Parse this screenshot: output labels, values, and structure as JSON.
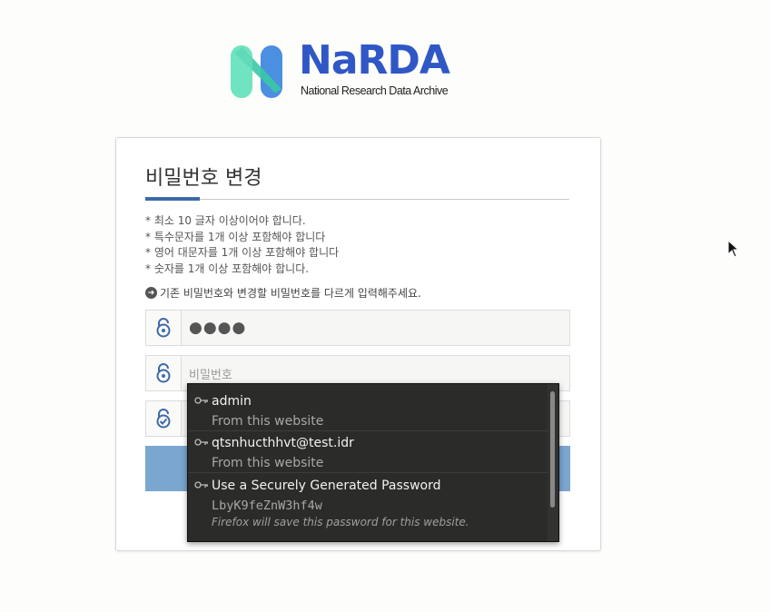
{
  "logo": {
    "name": "NaRDA",
    "subtitle": "National Research Data Archive"
  },
  "page": {
    "title": "비밀번호 변경",
    "rules": [
      "* 최소 10 글자 이상이어야 합니다.",
      "* 특수문자를 1개 이상 포함해야 합니다",
      "* 영어 대문자를 1개 이상 포함해야 합니다",
      "* 숫자를 1개 이상 포함해야 합니다."
    ],
    "notice": "기존 비밀번호와 변경할 비밀번호를 다르게 입력해주세요."
  },
  "fields": {
    "current_password_value": "●●●●",
    "new_password_placeholder": "비밀번호",
    "confirm_password_value": ""
  },
  "autocomplete": {
    "items": [
      {
        "main": "admin",
        "sub": "From this website"
      },
      {
        "main": "qtsnhucthhvt@test.idr",
        "sub": "From this website"
      },
      {
        "main": "Use a Securely Generated Password",
        "sub": "LbyK9feZnW3hf4w",
        "note": "Firefox will save this password for this website."
      }
    ]
  },
  "colors": {
    "brand_blue": "#2f57c6",
    "accent": "#3d6aa8",
    "button": "#7aa6d0",
    "popup_bg": "#2b2b29"
  }
}
